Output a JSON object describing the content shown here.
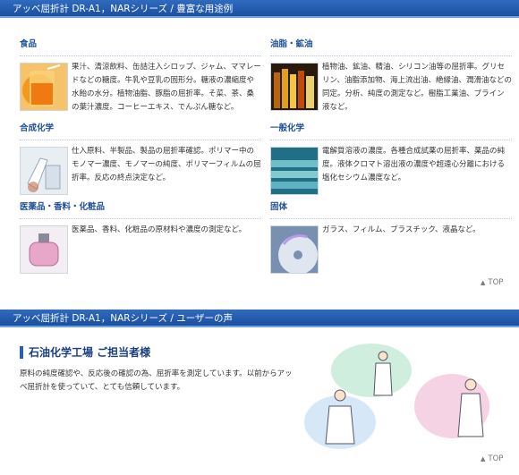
{
  "section1_title": "アッベ屈折計 DR-A1，NARシリーズ / 豊富な用途例",
  "categories": [
    {
      "title": "食品",
      "desc": "果汁、清涼飲料、缶詰注入シロップ、ジャム、ママレードなどの糖度。牛乳や豆乳の固形分。糖液の濃縮度や水飴の水分。植物油脂、豚脂の屈折率。そ菜、茶、桑の葉汁濃度。コーヒーエキス、でんぷん糖など。"
    },
    {
      "title": "油脂・鉱油",
      "desc": "植物油、鉱油、精油、シリコン油等の屈折率。グリセリン、油脂添加物、海上流出油、絶縁油、潤滑油などの同定。分析、純度の測定など。樹脂工業油、ブライン液など。"
    },
    {
      "title": "合成化学",
      "desc": "仕入原料、半製品、製品の屈折率確認。ポリマー中のモノマー濃度、モノマーの純度、ポリマーフィルムの屈折率。反応の終点決定など。"
    },
    {
      "title": "一般化学",
      "desc": "電解質溶液の濃度。各種合成試薬の屈折率、薬品の純度。液体クロマト溶出液の濃度や超遠心分離における塩化セシウム濃度など。"
    },
    {
      "title": "医薬品・香料・化粧品",
      "desc": "医薬品、香料、化粧品の原材料や濃度の測定など。"
    },
    {
      "title": "固体",
      "desc": "ガラス、フィルム、プラスチック、液晶など。"
    }
  ],
  "top_link": "TOP",
  "section2_title": "アッベ屈折計 DR-A1，NARシリーズ / ユーザーの声",
  "voice": {
    "heading": "石油化学工場 ご担当者様",
    "text": "原料の純度確認や、反応後の確認の為、屈折率を測定しています。以前からアッベ屈折計を使っていて、とても信頼しています。"
  }
}
